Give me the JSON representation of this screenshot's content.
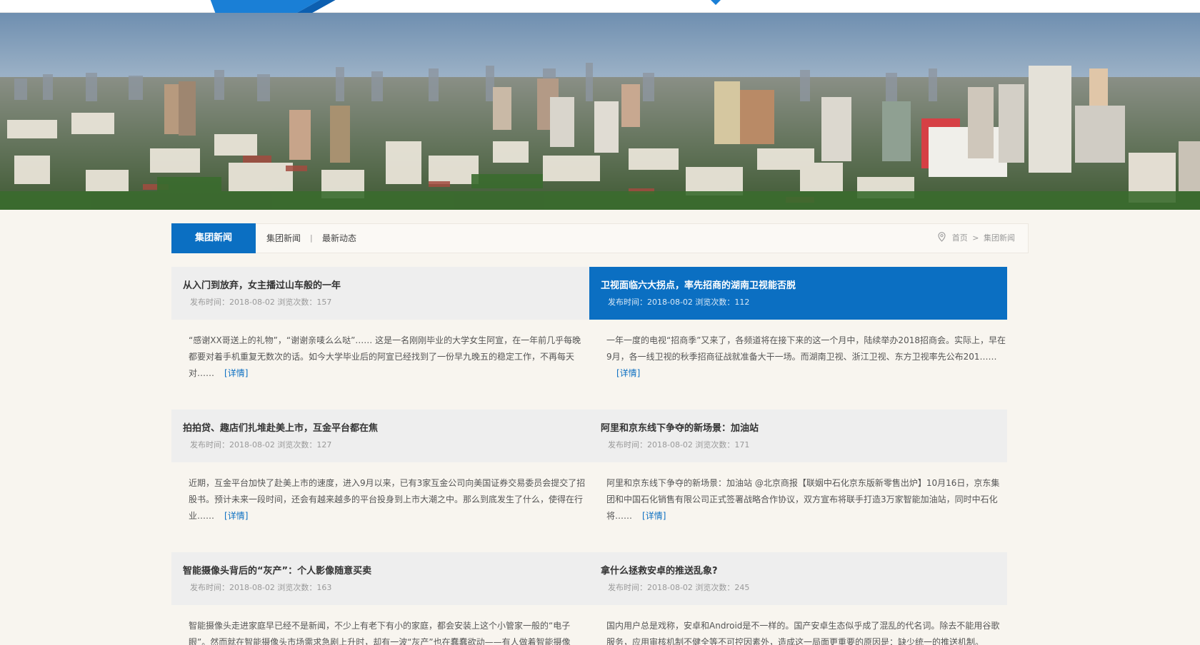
{
  "colors": {
    "accent": "#0b6fc2",
    "page_bg": "#f8f5ef"
  },
  "subnav": {
    "title": "集团新闻",
    "links": [
      "集团新闻",
      "最新动态"
    ],
    "separator": "|",
    "breadcrumb": {
      "icon": "location-pin-icon",
      "home": "首页",
      "arrow": ">",
      "current": "集团新闻"
    }
  },
  "news": [
    {
      "title": "从入门到放弃，女主播过山车般的一年",
      "meta": "发布时间：2018-08-02 浏览次数：157",
      "summary": "“感谢XX哥送上的礼物”，“谢谢亲唛么么哒”…… 这是一名刚刚毕业的大学女生阿宣，在一年前几乎每晚都要对着手机重复无数次的话。如今大学毕业后的阿宣已经找到了一份早九晚五的稳定工作，不再每天对……",
      "more": "[详情]"
    },
    {
      "title": "卫视面临六大拐点，率先招商的湖南卫视能否脱",
      "meta": "发布时间：2018-08-02 浏览次数：112",
      "summary": "一年一度的电视“招商季”又来了，各频道将在接下来的这一个月中，陆续举办2018招商会。实际上，早在9月，各一线卫视的秋季招商征战就准备大干一场。而湖南卫视、浙江卫视、东方卫视率先公布201……",
      "more": "[详情]"
    },
    {
      "title": "拍拍贷、趣店们扎堆赴美上市，互金平台都在焦",
      "meta": "发布时间：2018-08-02 浏览次数：127",
      "summary": "近期，互金平台加快了赴美上市的速度，进入9月以来，已有3家互金公司向美国证券交易委员会提交了招股书。预计未来一段时间，还会有越来越多的平台投身到上市大潮之中。那么到底发生了什么，使得在行业……",
      "more": "[详情]"
    },
    {
      "title": "阿里和京东线下争夺的新场景：加油站",
      "meta": "发布时间：2018-08-02 浏览次数：171",
      "summary": "阿里和京东线下争夺的新场景：加油站 @北京商报【联姻中石化京东版新零售出炉】10月16日，京东集团和中国石化销售有限公司正式签署战略合作协议，双方宣布将联手打造3万家智能加油站，同时中石化将……",
      "more": "[详情]"
    },
    {
      "title": "智能摄像头背后的“灰产”：个人影像随意买卖",
      "meta": "发布时间：2018-08-02 浏览次数：163",
      "summary": "智能摄像头走进家庭早已经不是新闻，不少上有老下有小的家庭，都会安装上这个小管家一般的“电子眼”。然而就在智能摄像头市场需求急剧上升时，却有一波“灰产”也在蠢蠢欲动——有人做着智能摄像",
      "more": ""
    },
    {
      "title": "拿什么拯救安卓的推送乱象?",
      "meta": "发布时间：2018-08-02 浏览次数：245",
      "summary": "国内用户总是戏称，安卓和Android是不一样的。国产安卓生态似乎成了混乱的代名词。除去不能用谷歌服务，应用审核机制不健全等不可控因素外，造成这一局面更重要的原因是：缺少统一的推送机制。&……",
      "more": ""
    }
  ]
}
